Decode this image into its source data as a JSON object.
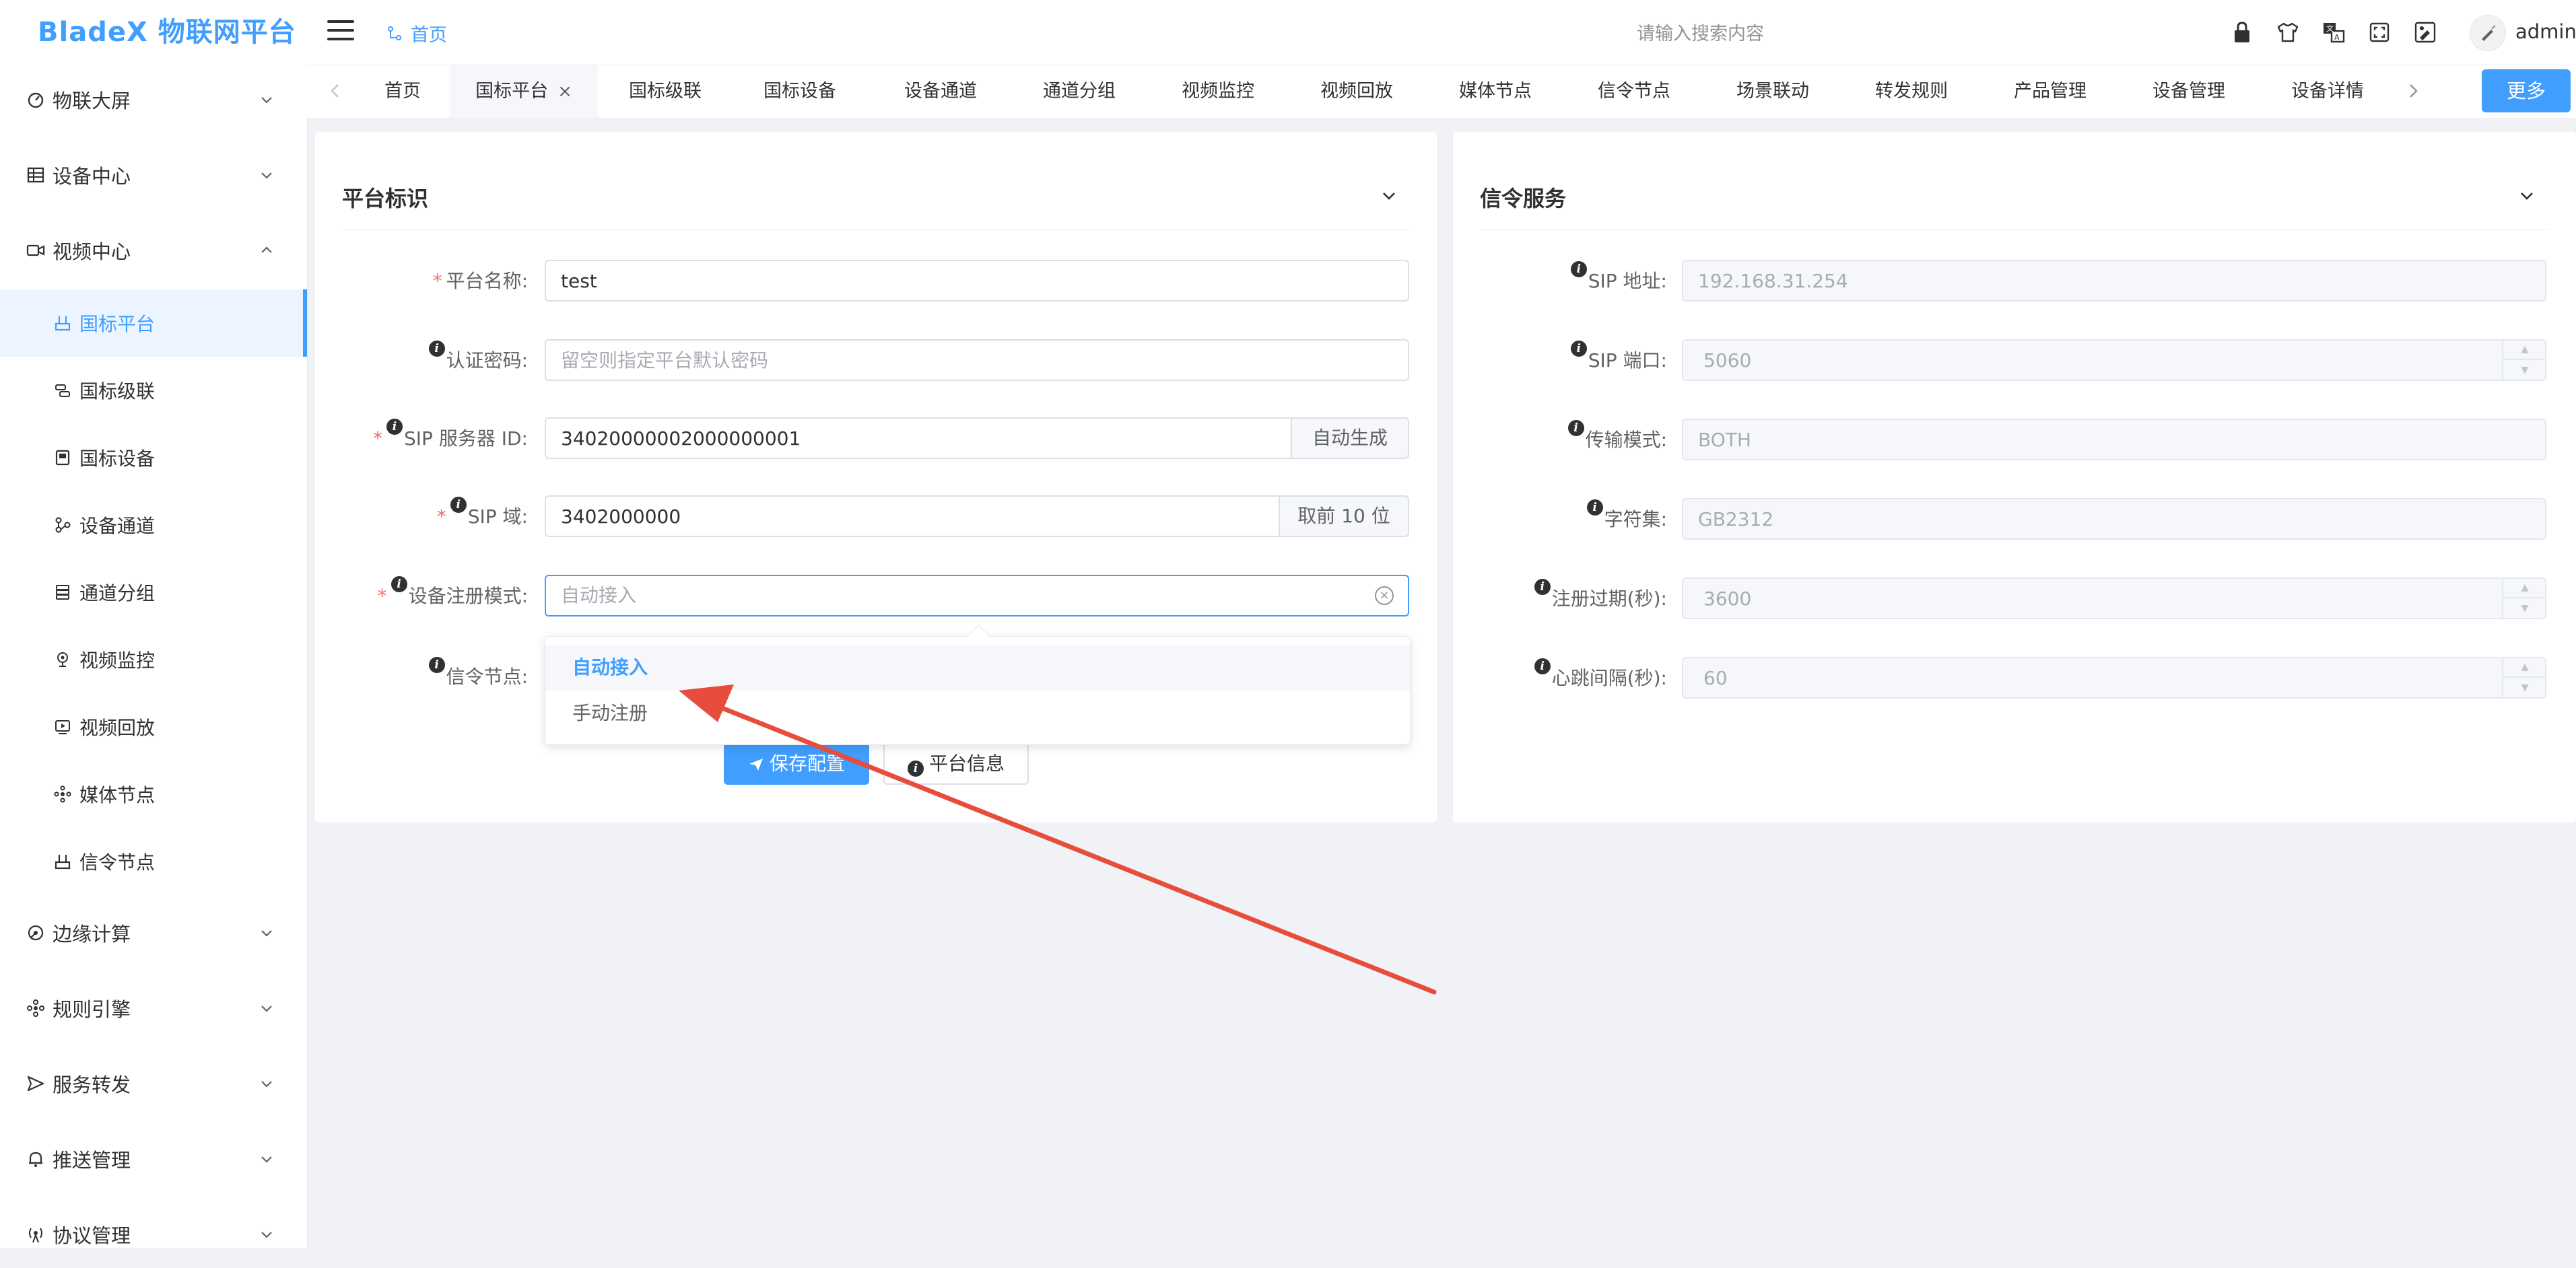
{
  "app": {
    "brand": "BladeX 物联网平台"
  },
  "header": {
    "breadcrumb": "首页",
    "search_placeholder": "请输入搜索内容",
    "icons": [
      "lock-icon",
      "shirt-icon",
      "translate-icon",
      "fullscreen-icon",
      "theme-icon"
    ],
    "username": "admin"
  },
  "sidebar": {
    "groups": [
      {
        "label": "物联大屏",
        "icon": "dashboard-icon",
        "expanded": false
      },
      {
        "label": "设备中心",
        "icon": "device-icon",
        "expanded": false
      },
      {
        "label": "视频中心",
        "icon": "video-icon",
        "expanded": true
      },
      {
        "label": "边缘计算",
        "icon": "edge-icon",
        "expanded": false
      },
      {
        "label": "规则引擎",
        "icon": "rule-icon",
        "expanded": false
      },
      {
        "label": "服务转发",
        "icon": "forward-icon",
        "expanded": false
      },
      {
        "label": "推送管理",
        "icon": "bell-icon",
        "expanded": false
      },
      {
        "label": "协议管理",
        "icon": "protocol-icon",
        "expanded": false
      }
    ],
    "video_children": [
      {
        "label": "国标平台",
        "active": true
      },
      {
        "label": "国标级联"
      },
      {
        "label": "国标设备"
      },
      {
        "label": "设备通道"
      },
      {
        "label": "通道分组"
      },
      {
        "label": "视频监控"
      },
      {
        "label": "视频回放"
      },
      {
        "label": "媒体节点"
      },
      {
        "label": "信令节点"
      }
    ]
  },
  "tabs": {
    "items": [
      "首页",
      "国标平台",
      "国标级联",
      "国标设备",
      "设备通道",
      "通道分组",
      "视频监控",
      "视频回放",
      "媒体节点",
      "信令节点",
      "场景联动",
      "转发规则",
      "产品管理",
      "设备管理",
      "设备详情"
    ],
    "active": "国标平台",
    "close_glyph": "×",
    "more": "更多"
  },
  "platform_card": {
    "title": "平台标识",
    "fields": {
      "name": {
        "label": "平台名称:",
        "value": "test"
      },
      "password": {
        "label": "认证密码:",
        "placeholder": "留空则指定平台默认密码"
      },
      "sip_id": {
        "label": "SIP 服务器 ID:",
        "value": "34020000002000000001",
        "append": "自动生成"
      },
      "sip_domain": {
        "label": "SIP 域:",
        "value": "3402000000",
        "append": "取前 10 位"
      },
      "register_mode": {
        "label": "设备注册模式:",
        "placeholder": "自动接入",
        "options": [
          "自动接入",
          "手动注册"
        ],
        "selected": "自动接入"
      },
      "signal_node": {
        "label": "信令节点:"
      }
    },
    "buttons": {
      "save": "保存配置",
      "info": "平台信息"
    }
  },
  "signal_card": {
    "title": "信令服务",
    "fields": [
      {
        "label": "SIP 地址:",
        "value": "192.168.31.254",
        "spinner": false
      },
      {
        "label": "SIP 端口:",
        "value": "5060",
        "spinner": true
      },
      {
        "label": "传输模式:",
        "value": "BOTH",
        "spinner": false
      },
      {
        "label": "字符集:",
        "value": "GB2312",
        "spinner": false
      },
      {
        "label": "注册过期(秒):",
        "value": "3600",
        "spinner": true
      },
      {
        "label": "心跳间隔(秒):",
        "value": "60",
        "spinner": true
      }
    ]
  },
  "colors": {
    "primary": "#409eff",
    "required": "#f56c6c",
    "annotation_arrow": "#e74c3c"
  }
}
